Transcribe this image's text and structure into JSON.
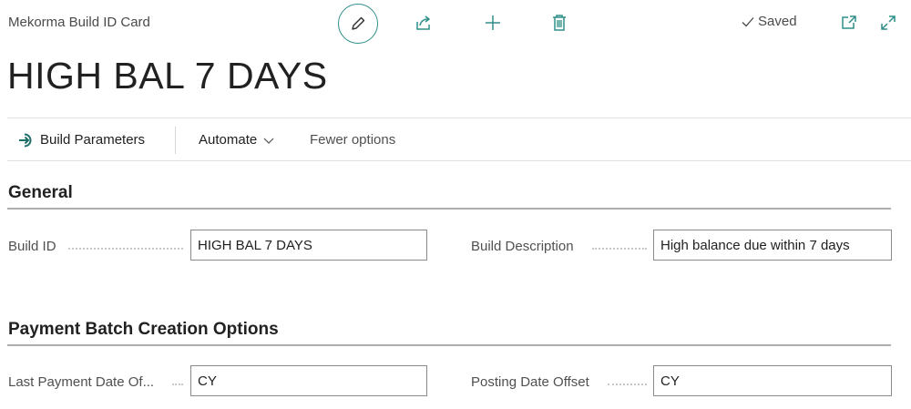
{
  "header": {
    "caption": "Mekorma Build ID Card",
    "status": "Saved"
  },
  "page": {
    "title": "HIGH BAL 7 DAYS"
  },
  "actions": {
    "build_parameters": "Build Parameters",
    "automate": "Automate",
    "fewer_options": "Fewer options"
  },
  "general": {
    "title": "General",
    "build_id_label": "Build ID",
    "build_id_value": "HIGH BAL 7 DAYS",
    "build_description_label": "Build Description",
    "build_description_value": "High balance due within 7 days"
  },
  "payment_batch": {
    "title": "Payment Batch Creation Options",
    "last_payment_date_label": "Last Payment Date Of...",
    "last_payment_date_value": "CY",
    "posting_date_offset_label": "Posting Date Offset",
    "posting_date_offset_value": "CY"
  },
  "colors": {
    "accent": "#2f8f88",
    "text": "#212121",
    "muted": "#505050"
  },
  "icons": [
    "edit-icon",
    "share-icon",
    "plus-icon",
    "trash-icon",
    "checkmark-icon",
    "popout-icon",
    "expand-icon",
    "arrow-in-icon",
    "chevron-down-icon"
  ]
}
